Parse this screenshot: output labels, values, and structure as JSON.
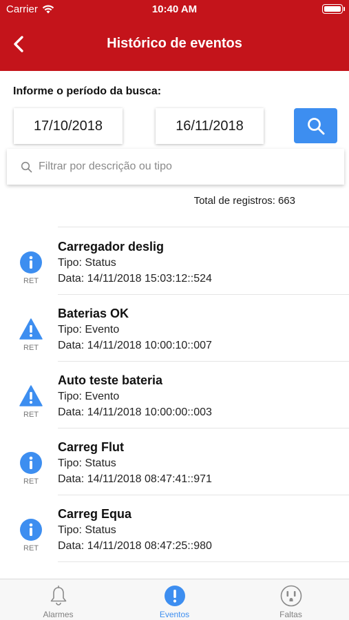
{
  "status": {
    "carrier": "Carrier",
    "time": "10:40 AM"
  },
  "header": {
    "title": "Histórico de eventos",
    "back_icon": "chevron-left-icon"
  },
  "search": {
    "period_label": "Informe o período da busca:",
    "start_date": "17/10/2018",
    "end_date": "16/11/2018",
    "filter_placeholder": "Filtrar por descrição ou tipo",
    "filter_value": ""
  },
  "total": {
    "label": "Total de registros:",
    "value": "663"
  },
  "events": [
    {
      "title": "Carregador deslig",
      "type": "Tipo: Status",
      "date": "Data: 14/11/2018 15:03:12::524",
      "source": "RET",
      "icon": "info-icon"
    },
    {
      "title": "Baterias OK",
      "type": "Tipo: Evento",
      "date": "Data: 14/11/2018 10:00:10::007",
      "source": "RET",
      "icon": "warning-icon"
    },
    {
      "title": "Auto teste bateria",
      "type": "Tipo: Evento",
      "date": "Data: 14/11/2018 10:00:00::003",
      "source": "RET",
      "icon": "warning-icon"
    },
    {
      "title": "Carreg Flut",
      "type": "Tipo: Status",
      "date": "Data: 14/11/2018 08:47:41::971",
      "source": "RET",
      "icon": "info-icon"
    },
    {
      "title": "Carreg Equa",
      "type": "Tipo: Status",
      "date": "Data: 14/11/2018 08:47:25::980",
      "source": "RET",
      "icon": "info-icon"
    }
  ],
  "tabs": [
    {
      "label": "Alarmes",
      "icon": "bell-icon",
      "active": false
    },
    {
      "label": "Eventos",
      "icon": "exclamation-circle-icon",
      "active": true
    },
    {
      "label": "Faltas",
      "icon": "outlet-icon",
      "active": false
    }
  ],
  "colors": {
    "primary": "#c4141b",
    "accent": "#3d8ef0",
    "inactive": "#7f7f7f"
  }
}
